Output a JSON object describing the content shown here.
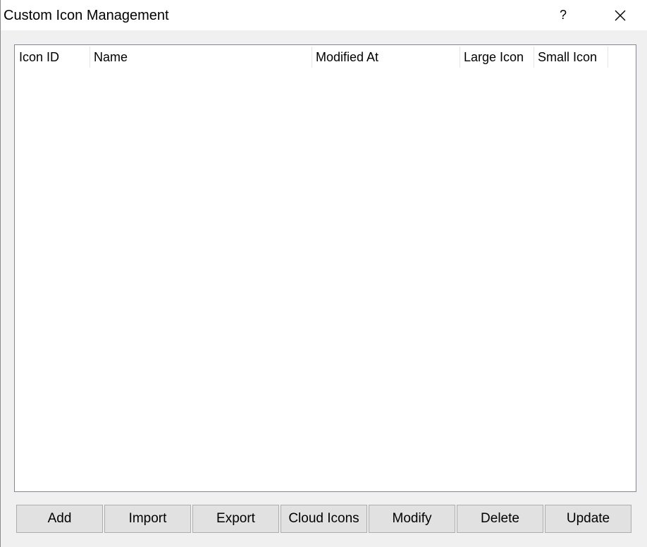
{
  "window": {
    "title": "Custom Icon Management",
    "help_label": "?",
    "close_icon": "close-icon"
  },
  "table": {
    "columns": [
      {
        "label": "Icon ID"
      },
      {
        "label": "Name"
      },
      {
        "label": "Modified At"
      },
      {
        "label": "Large Icon"
      },
      {
        "label": "Small Icon"
      }
    ],
    "rows": []
  },
  "buttons": [
    {
      "label": "Add"
    },
    {
      "label": "Import"
    },
    {
      "label": "Export"
    },
    {
      "label": "Cloud Icons"
    },
    {
      "label": "Modify"
    },
    {
      "label": "Delete"
    },
    {
      "label": "Update"
    }
  ]
}
